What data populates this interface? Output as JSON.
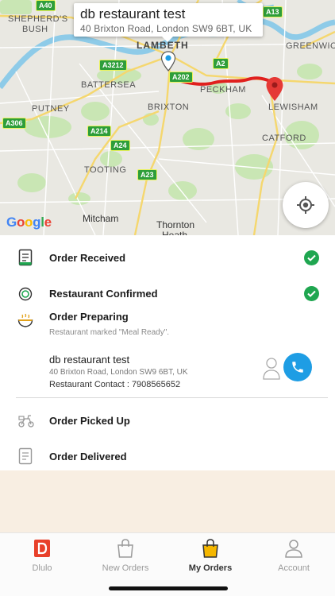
{
  "map": {
    "callout": {
      "title": "db restaurant test",
      "address": "40 Brixton Road, London SW9 6BT, UK"
    },
    "labels": {
      "shepherds_bush": "SHEPHERD'S\nBUSH",
      "shepherds": "SHEPHERD'S",
      "bush": "BUSH",
      "lambeth": "LAMBETH",
      "greenwich": "GREENWICH",
      "battersea": "BATTERSEA",
      "putney": "PUTNEY",
      "brixton": "BRIXTON",
      "peckham": "PECKHAM",
      "lewisham": "LEWISHAM",
      "catford": "CATFORD",
      "tooting": "TOOTING",
      "mitcham": "Mitcham",
      "thornton": "Thornton",
      "heath": "Heath"
    },
    "roads": {
      "a40": "A40",
      "a13": "A13",
      "a3212": "A3212",
      "a2": "A2",
      "a202": "A202",
      "a306": "A306",
      "a214": "A214",
      "a24": "A24",
      "a23": "A23"
    },
    "google": [
      "G",
      "o",
      "o",
      "g",
      "l",
      "e"
    ],
    "route_color": "#e0201e",
    "pin_color": "#e53935"
  },
  "steps": {
    "received": {
      "label": "Order Received",
      "done": true
    },
    "confirmed": {
      "label": "Restaurant Confirmed",
      "done": true
    },
    "preparing": {
      "label": "Order Preparing",
      "sub": "Restaurant marked \"Meal Ready\"."
    },
    "picked_up": {
      "label": "Order Picked Up"
    },
    "delivered": {
      "label": "Order Delivered"
    }
  },
  "restaurant": {
    "name": "db restaurant test",
    "address": "40 Brixton Road, London SW9 6BT, UK",
    "contact": "Restaurant Contact : 7908565652"
  },
  "tabs": [
    {
      "label": "Dlulo",
      "icon": "dlulo-logo-icon"
    },
    {
      "label": "New Orders",
      "icon": "shopping-bag-icon"
    },
    {
      "label": "My Orders",
      "icon": "shopping-bag-filled-icon",
      "active": true
    },
    {
      "label": "Account",
      "icon": "person-icon"
    }
  ],
  "colors": {
    "check_green": "#1fa650",
    "call_blue": "#1e9de4",
    "active_tab_bag": "#f5b700",
    "brand_red": "#e8402a",
    "cream_panel": "#f8eee2"
  }
}
